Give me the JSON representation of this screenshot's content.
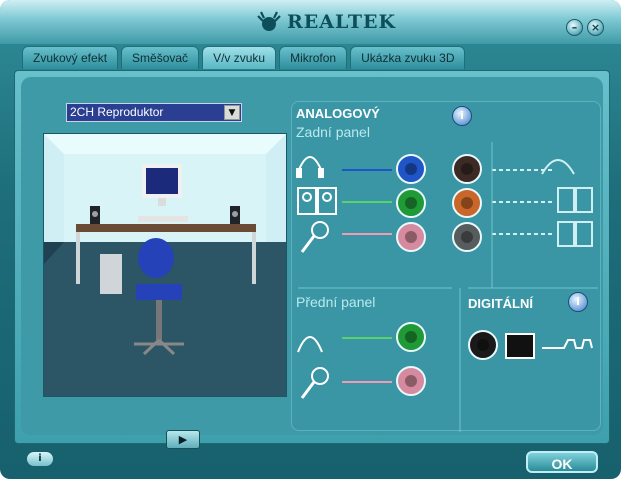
{
  "app": {
    "brand": "REALTEK"
  },
  "tabs": [
    {
      "label": "Zvukový efekt"
    },
    {
      "label": "Směšovač"
    },
    {
      "label": "V/v zvuku"
    },
    {
      "label": "Mikrofon"
    },
    {
      "label": "Ukázka zvuku 3D"
    }
  ],
  "speaker_select": {
    "value": "2CH Reproduktor"
  },
  "analog": {
    "title": "ANALOGOVÝ",
    "rear_panel": "Zadní panel",
    "front_panel": "Přední panel"
  },
  "digital": {
    "title": "DIGITÁLNÍ"
  },
  "buttons": {
    "ok": "OK"
  },
  "colors": {
    "blue_jack": "#1f55c6",
    "green_jack": "#1f9a37",
    "pink_jack": "#d58a9f",
    "black_jack": "#3b2b24",
    "orange_jack": "#c9672a",
    "gray_jack": "#575c5c"
  },
  "icons": {
    "minimize": "minimize-icon",
    "close": "close-icon",
    "info": "info-icon",
    "play": "play-icon"
  }
}
